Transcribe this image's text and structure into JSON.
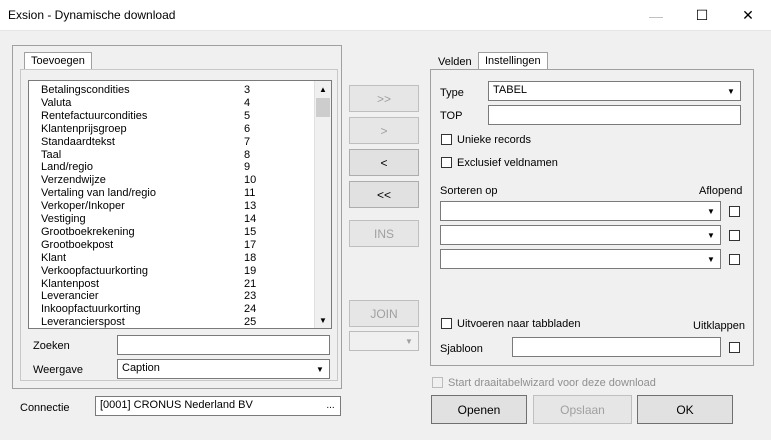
{
  "window": {
    "title": "Exsion - Dynamische download",
    "minimize": "—",
    "maximize": "☐",
    "close": "✕"
  },
  "left": {
    "tab_label": "Toevoegen",
    "list_items": [
      {
        "name": "Betalingscondities",
        "num": "3"
      },
      {
        "name": "Valuta",
        "num": "4"
      },
      {
        "name": "Rentefactuurcondities",
        "num": "5"
      },
      {
        "name": "Klantenprijsgroep",
        "num": "6"
      },
      {
        "name": "Standaardtekst",
        "num": "7"
      },
      {
        "name": "Taal",
        "num": "8"
      },
      {
        "name": "Land/regio",
        "num": "9"
      },
      {
        "name": "Verzendwijze",
        "num": "10"
      },
      {
        "name": "Vertaling van land/regio",
        "num": "11"
      },
      {
        "name": "Verkoper/Inkoper",
        "num": "13"
      },
      {
        "name": "Vestiging",
        "num": "14"
      },
      {
        "name": "Grootboekrekening",
        "num": "15"
      },
      {
        "name": "Grootboekpost",
        "num": "17"
      },
      {
        "name": "Klant",
        "num": "18"
      },
      {
        "name": "Verkoopfactuurkorting",
        "num": "19"
      },
      {
        "name": "Klantenpost",
        "num": "21"
      },
      {
        "name": "Leverancier",
        "num": "23"
      },
      {
        "name": "Inkoopfactuurkorting",
        "num": "24"
      },
      {
        "name": "Leverancierspost",
        "num": "25"
      }
    ],
    "search_label": "Zoeken",
    "search_value": "",
    "display_label": "Weergave",
    "display_value": "Caption"
  },
  "middle": {
    "add_all": ">>",
    "add_one": ">",
    "remove_one": "<",
    "remove_all": "<<",
    "ins": "INS",
    "join": "JOIN",
    "join_select_value": ""
  },
  "right": {
    "tab_fields": "Velden",
    "tab_settings": "Instellingen",
    "type_label": "Type",
    "type_value": "TABEL",
    "top_label": "TOP",
    "top_value": "",
    "unique_label": "Unieke records",
    "exclusive_label": "Exclusief veldnamen",
    "sort_label": "Sorteren op",
    "desc_label": "Aflopend",
    "sort_rows": [
      "",
      "",
      ""
    ],
    "export_tabs_label": "Uitvoeren naar tabbladen",
    "collapse_label": "Uitklappen",
    "template_label": "Sjabloon",
    "template_value": ""
  },
  "bottom": {
    "connection_label": "Connectie",
    "connection_value": "[0001] CRONUS Nederland BV",
    "browse": "...",
    "pivot_label": "Start draaitabelwizard voor deze download",
    "open": "Openen",
    "save": "Opslaan",
    "ok": "OK"
  }
}
